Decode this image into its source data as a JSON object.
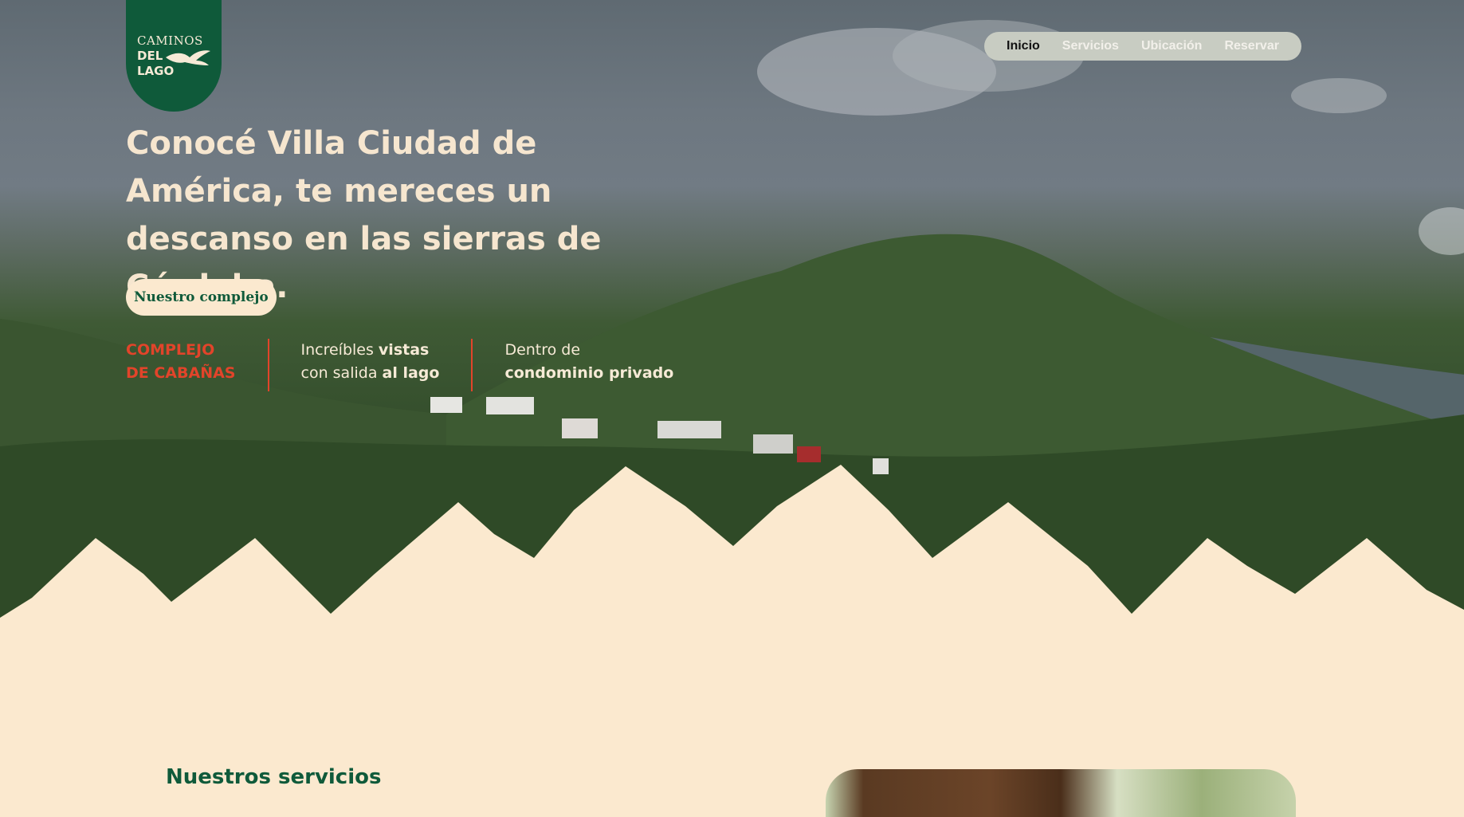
{
  "logo": {
    "line1": "CAMINOS",
    "line2": "DEL",
    "line3": "LAGO",
    "icon": "bird-icon"
  },
  "nav": {
    "items": [
      "Inicio",
      "Servicios",
      "Ubicación",
      "Reservar"
    ],
    "active": "Inicio"
  },
  "hero": {
    "headline": "Conocé Villa Ciudad de América, te mereces un descanso en las sierras de Córdoba.",
    "cta_label": "Nuestro complejo",
    "features": {
      "f1_line1": "COMPLEJO",
      "f1_line2": "DE CABAÑAS",
      "f2_a": "Increíbles ",
      "f2_b": "vistas",
      "f2_c": "con salida ",
      "f2_d": "al lago",
      "f3_a": "Dentro de",
      "f3_b": "condominio privado"
    }
  },
  "services": {
    "title": "Nuestros servicios"
  },
  "colors": {
    "brand_green": "#0f5a3a",
    "cream": "#fbe9cf",
    "accent_red": "#e2442a",
    "nav_bg": "#c8ccc2"
  }
}
